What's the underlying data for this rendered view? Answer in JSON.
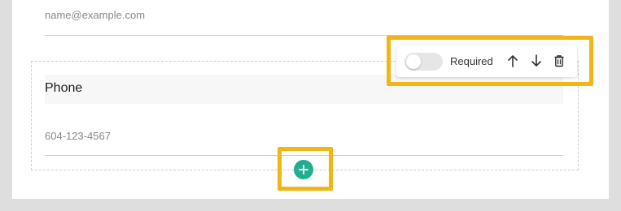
{
  "previous_field": {
    "placeholder": "name@example.com"
  },
  "phone_field": {
    "label": "Phone",
    "placeholder": "604-123-4567"
  },
  "toolbar": {
    "required_label": "Required",
    "required_enabled": false,
    "icons": [
      "arrow-up-icon",
      "arrow-down-icon",
      "trash-icon"
    ]
  },
  "add_button": {
    "icon": "plus-icon"
  },
  "colors": {
    "highlight": "#f2b516",
    "accent": "#1fae8e",
    "toggle_track": "#e6e6e6"
  }
}
